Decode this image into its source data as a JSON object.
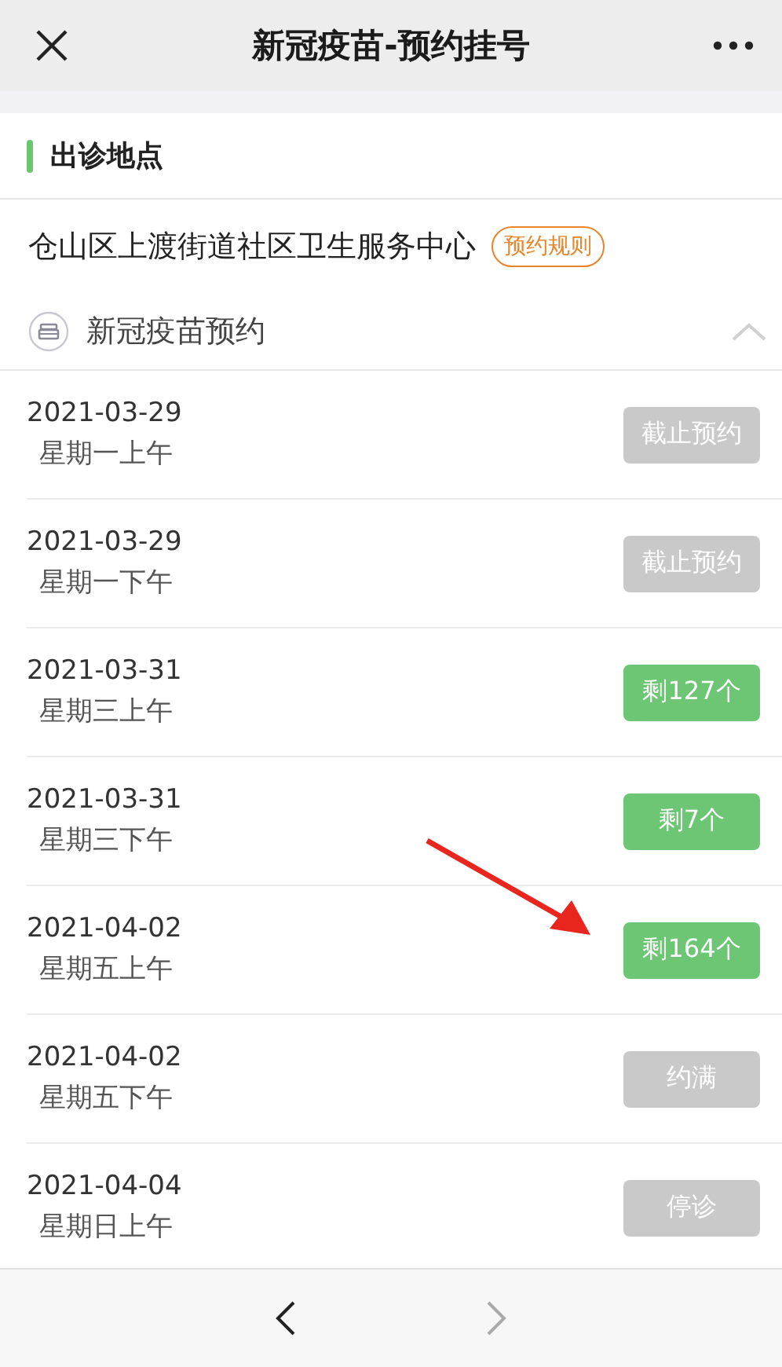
{
  "window": {
    "title": "新冠疫苗-预约挂号"
  },
  "section": {
    "title": "出诊地点"
  },
  "clinic": {
    "name": "仓山区上渡街道社区卫生服务中心",
    "rules_link": "预约规则"
  },
  "vaccine": {
    "name": "新冠疫苗预约",
    "expanded": true
  },
  "slots": [
    {
      "date": "2021-03-29",
      "period": "星期一上午",
      "available": false,
      "label": "截止预约"
    },
    {
      "date": "2021-03-29",
      "period": "星期一下午",
      "available": false,
      "label": "截止预约"
    },
    {
      "date": "2021-03-31",
      "period": "星期三上午",
      "available": true,
      "label": "剩127个"
    },
    {
      "date": "2021-03-31",
      "period": "星期三下午",
      "available": true,
      "label": "剩7个"
    },
    {
      "date": "2021-04-02",
      "period": "星期五上午",
      "available": true,
      "label": "剩164个"
    },
    {
      "date": "2021-04-02",
      "period": "星期五下午",
      "available": false,
      "label": "约满"
    },
    {
      "date": "2021-04-04",
      "period": "星期日上午",
      "available": false,
      "label": "停诊"
    }
  ],
  "nav": {
    "back_disabled": false,
    "forward_disabled": true
  }
}
